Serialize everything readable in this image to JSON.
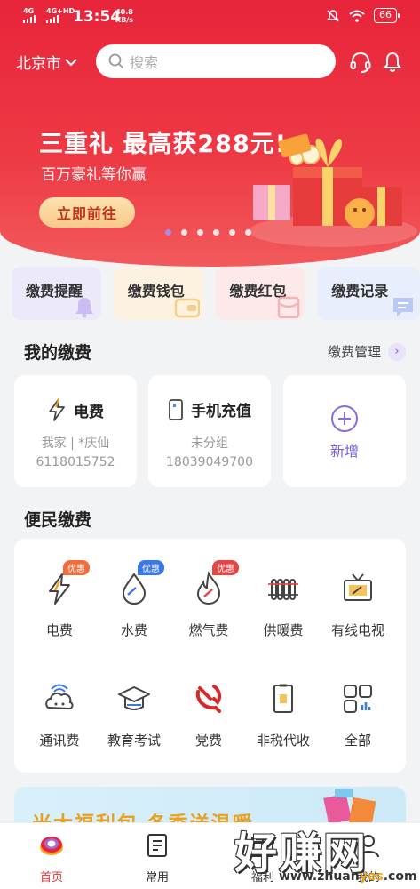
{
  "status_bar": {
    "net1": "4G",
    "net2": "4G+HD",
    "time": "13:54",
    "speed_value": "40.8",
    "speed_unit": "KB/s",
    "battery": "66"
  },
  "header": {
    "city": "北京市",
    "search_placeholder": "搜索"
  },
  "banner": {
    "title": "三重礼 最高获288元!",
    "subtitle": "百万豪礼等你赢",
    "button": "立即前往",
    "slide_count": 6,
    "active_slide": 0
  },
  "quick_entries": [
    {
      "label": "缴费提醒",
      "icon": "bell-icon"
    },
    {
      "label": "缴费钱包",
      "icon": "wallet-icon"
    },
    {
      "label": "缴费红包",
      "icon": "red-envelope-icon"
    },
    {
      "label": "缴费记录",
      "icon": "record-icon"
    }
  ],
  "my_payments": {
    "title": "我的缴费",
    "manage": "缴费管理",
    "cards": [
      {
        "name": "电费",
        "line1": "我家 | *庆仙",
        "line2": "6118015752",
        "icon": "lightning-icon"
      },
      {
        "name": "手机充值",
        "line1": "未分组",
        "line2": "18039049700",
        "icon": "phone-icon"
      }
    ],
    "add_label": "新增"
  },
  "services": {
    "title": "便民缴费",
    "items": [
      {
        "label": "电费",
        "badge": "优惠",
        "icon": "lightning-icon"
      },
      {
        "label": "水费",
        "badge": "优惠",
        "icon": "water-drop-icon"
      },
      {
        "label": "燃气费",
        "badge": "优惠",
        "icon": "flame-icon"
      },
      {
        "label": "供暖费",
        "badge": "",
        "icon": "radiator-icon"
      },
      {
        "label": "有线电视",
        "badge": "",
        "icon": "tv-icon"
      },
      {
        "label": "通讯费",
        "badge": "",
        "icon": "signal-icon"
      },
      {
        "label": "教育考试",
        "badge": "",
        "icon": "graduation-cap-icon"
      },
      {
        "label": "党费",
        "badge": "",
        "icon": "party-emblem-icon"
      },
      {
        "label": "非税代收",
        "badge": "",
        "icon": "receipt-icon"
      },
      {
        "label": "全部",
        "badge": "",
        "icon": "grid-icon"
      }
    ]
  },
  "promo": {
    "text": "米大福利包 冬季送温暖"
  },
  "tabbar": [
    {
      "label": "首页",
      "icon": "home-logo-icon",
      "active": true
    },
    {
      "label": "常用",
      "icon": "document-icon",
      "active": false
    },
    {
      "label": "福利",
      "icon": "gift-icon",
      "active": false
    },
    {
      "label": "我的",
      "icon": "user-icon",
      "active": false
    }
  ],
  "watermark": {
    "big": "好赚网",
    "url_a": "www.zhuan",
    "url_b": "yes",
    "url_c": ".com"
  },
  "colors": {
    "brand_red": "#e8243a",
    "accent_purple": "#7b5cd6",
    "active_tab": "#e03030"
  }
}
